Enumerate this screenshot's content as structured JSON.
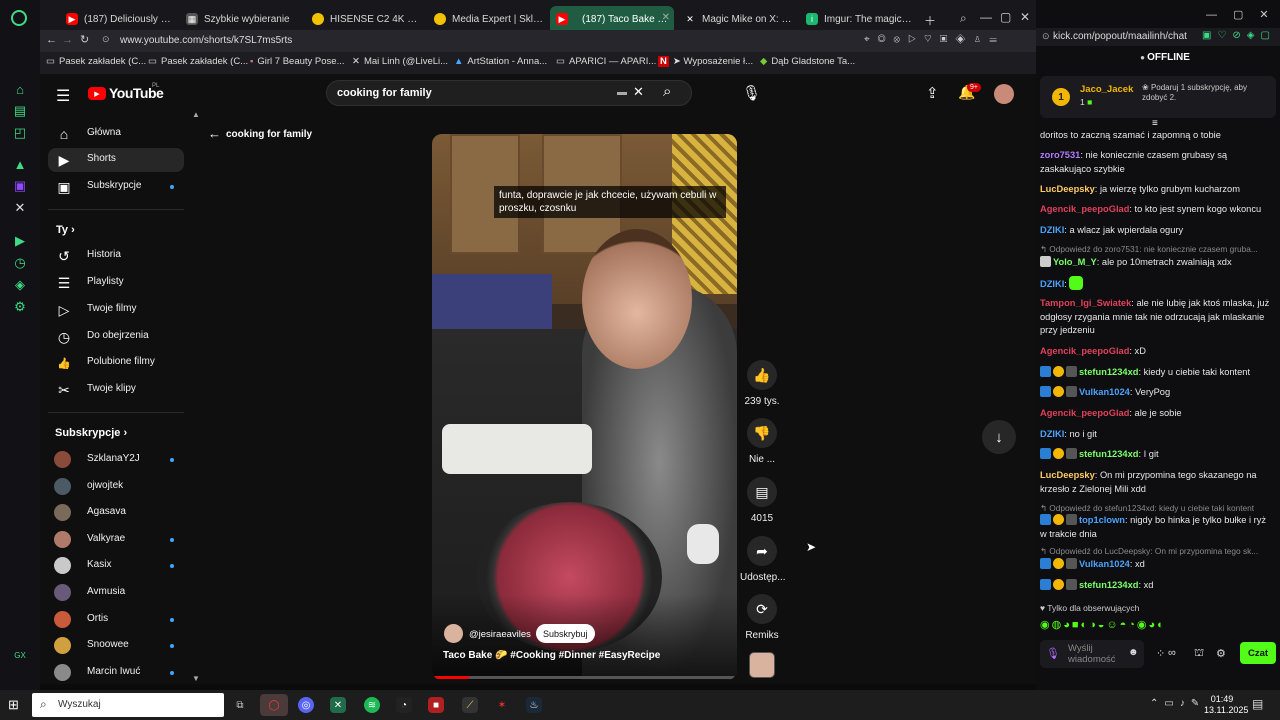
{
  "browser": {
    "tabs": [
      {
        "label": "(187) Deliciously Easy N",
        "icon_color": "#ff0000",
        "icon": "▶"
      },
      {
        "label": "Szybkie wybieranie",
        "icon_color": "#555555",
        "icon": "▦"
      },
      {
        "label": "HISENSE C2 4K UHD (3",
        "icon_color": "#f2c200",
        "icon": "●"
      },
      {
        "label": "Media Expert | Sklep in",
        "icon_color": "#f2c200",
        "icon": "●"
      },
      {
        "label": "(187) Taco Bake 🌮 #",
        "icon_color": "#ff0000",
        "icon": "▶"
      },
      {
        "label": "Magic Mike on X: \"@Th",
        "icon_color": "#222222",
        "icon": "X"
      },
      {
        "label": "Imgur: The magic of the",
        "icon_color": "#1bb76e",
        "icon": "i"
      }
    ],
    "url": "www.youtube.com/shorts/k7SL7ms5rts",
    "bookmarks": [
      "Pasek zakładek (C...",
      "Pasek zakładek (C...",
      "Girl 7 Beauty Pose...",
      "Mai Linh (@LiveLi...",
      "ArtStation - Anna...",
      "APARICI — APARI...",
      "➤ Wyposażenie ł...",
      "Dąb Gladstone Ta..."
    ],
    "popout_url": "kick.com/popout/maailinh/chat"
  },
  "youtube": {
    "logo": "YouTube",
    "region": "PL",
    "search_value": "cooking for family",
    "notif_count": "9+",
    "back_label": "cooking for family",
    "nav": [
      {
        "label": "Główna",
        "icon": "⌂"
      },
      {
        "label": "Shorts",
        "icon": "▶"
      },
      {
        "label": "Subskrypcje",
        "icon": "▣"
      }
    ],
    "you_header": "Ty",
    "you_items": [
      {
        "label": "Historia",
        "icon": "↺"
      },
      {
        "label": "Playlisty",
        "icon": "☰"
      },
      {
        "label": "Twoje filmy",
        "icon": "▷"
      },
      {
        "label": "Do obejrzenia",
        "icon": "◷"
      },
      {
        "label": "Polubione filmy",
        "icon": "👍"
      },
      {
        "label": "Twoje klipy",
        "icon": "✂"
      }
    ],
    "subs_header": "Subskrypcje",
    "subs": [
      {
        "label": "SzklanaY2J",
        "color": "#8a4b3a",
        "dot": true
      },
      {
        "label": "ojwojtek",
        "color": "#4c5a66",
        "dot": false
      },
      {
        "label": "Agasava",
        "color": "#7a6a5a",
        "dot": false
      },
      {
        "label": "Valkyrae",
        "color": "#b07a6a",
        "dot": true
      },
      {
        "label": "Kasix",
        "color": "#c9c9c9",
        "dot": true
      },
      {
        "label": "Avmusia",
        "color": "#6a5a7a",
        "dot": false
      },
      {
        "label": "Ortis",
        "color": "#c95a3a",
        "dot": true
      },
      {
        "label": "Snoowee",
        "color": "#d0a040",
        "dot": true
      },
      {
        "label": "Marcin Iwuć",
        "color": "#8a8a8a",
        "dot": true
      }
    ],
    "short": {
      "caption": "funta, doprawcie je jak chcecie, używam cebuli w proszku, czosnku",
      "channel": "@jesiraeaviles",
      "subscribe": "Subskrybuj",
      "title": "Taco Bake 🌮 #Cooking #Dinner #EasyRecipe",
      "progress": 0.12
    },
    "actions": [
      {
        "label": "239 tys.",
        "icon": "👍"
      },
      {
        "label": "Nie ...",
        "icon": "👎"
      },
      {
        "label": "4015",
        "icon": "▤"
      },
      {
        "label": "Udostęp...",
        "icon": "➦"
      },
      {
        "label": "Remiks",
        "icon": "⟳"
      }
    ]
  },
  "kick": {
    "status": "OFFLINE",
    "top_user": "Jaco_Jacek",
    "top_user_count": "1",
    "top_promo": "Podaruj 1 subskrypcję, aby zdobyć 2.",
    "messages": [
      {
        "type": "msg",
        "user": "",
        "color": "#ffffff",
        "text": "doritos to zaczną szamać i zapomną o tobie"
      },
      {
        "type": "msg",
        "user": "zoro7531",
        "color": "#b27cff",
        "text": ": nie koniecznie czasem grubasy są zaskakująco szybkie"
      },
      {
        "type": "msg",
        "user": "LucDeepsky",
        "color": "#ffcc66",
        "text": ": ja wierzę tylko grubym kucharzom"
      },
      {
        "type": "msg",
        "user": "Agencik_peepoGlad",
        "color": "#e0405a",
        "text": ": to kto jest synem kogo wkoncu"
      },
      {
        "type": "msg",
        "user": "DZIKI",
        "color": "#4aa3ff",
        "text": ": a wlacz jak wpierdala ogury"
      },
      {
        "type": "reply",
        "text": "Odpowiedź do zoro7531: nie koniecznie czasem gruba..."
      },
      {
        "type": "msg",
        "user": "Yolo_M_Y",
        "color": "#7cff6b",
        "text": ": ale po 10metrach zwalniają xdx"
      },
      {
        "type": "msg",
        "user": "DZIKI",
        "color": "#4aa3ff",
        "text": ":"
      },
      {
        "type": "msg",
        "user": "Tampon_Igi_Swiatek",
        "color": "#e0405a",
        "text": ": ale nie lubię jak ktoś mlaska, już odgłosy rzygania mnie tak nie odrzucają jak mlaskanie przy jedzeniu"
      },
      {
        "type": "msg",
        "user": "Agencik_peepoGlad",
        "color": "#e0405a",
        "text": ": xD"
      },
      {
        "type": "msg",
        "user": "stefun1234xd",
        "color": "#7cff6b",
        "text": ": kiedy u ciebie taki kontent"
      },
      {
        "type": "msg",
        "user": "Vulkan1024",
        "color": "#4aa3ff",
        "text": ": VeryPog"
      },
      {
        "type": "msg",
        "user": "Agencik_peepoGlad",
        "color": "#e0405a",
        "text": ": ale je sobie"
      },
      {
        "type": "msg",
        "user": "DZIKI",
        "color": "#4aa3ff",
        "text": ": no i git"
      },
      {
        "type": "msg",
        "user": "stefun1234xd",
        "color": "#7cff6b",
        "text": ": I git"
      },
      {
        "type": "msg",
        "user": "LucDeepsky",
        "color": "#ffcc66",
        "text": ": On mi przypomina tego skazanego na krzesło z Zielonej Mili xdd"
      },
      {
        "type": "reply",
        "text": "Odpowiedź do stefun1234xd: kiedy u ciebie taki kontent"
      },
      {
        "type": "msg",
        "user": "top1clown",
        "color": "#4aa3ff",
        "text": ": nigdy bo hinka je tylko bułke i ryż w trakcie dnia"
      },
      {
        "type": "reply",
        "text": "Odpowiedź do LucDeepsky: On mi przypomina tego sk..."
      },
      {
        "type": "msg",
        "user": "Vulkan1024",
        "color": "#4aa3ff",
        "text": ": xd"
      },
      {
        "type": "msg",
        "user": "stefun1234xd",
        "color": "#7cff6b",
        "text": ": xd"
      }
    ],
    "followers_only": "Tylko dla obserwujących",
    "input_placeholder": "Wyślij wiadomość",
    "send_label": "Czat"
  },
  "taskbar": {
    "search_placeholder": "Wyszukaj",
    "time": "01:49",
    "date": "13.11.2025"
  }
}
